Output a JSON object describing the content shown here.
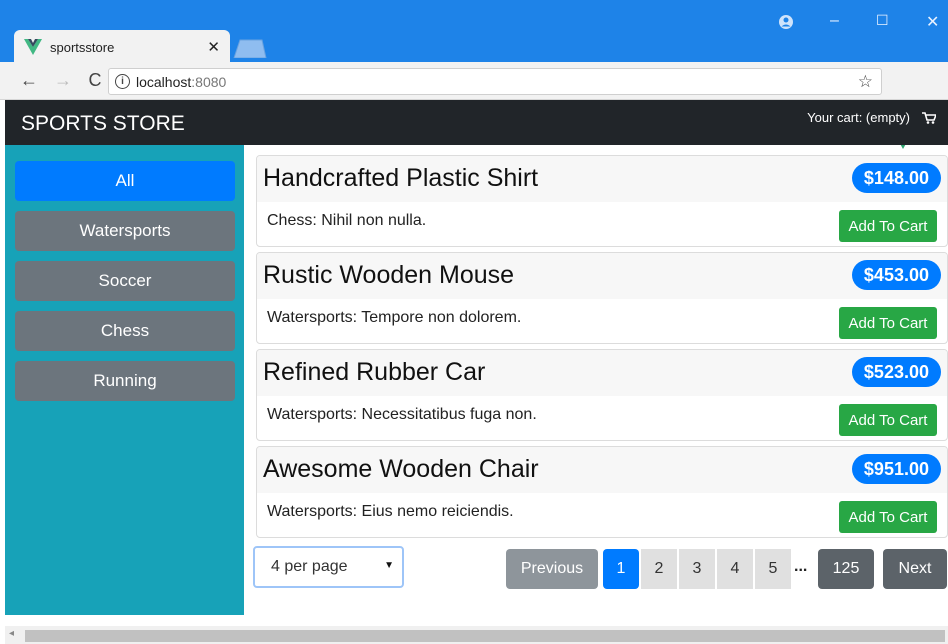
{
  "browser": {
    "tab_title": "sportsstore",
    "tab_close": "✕",
    "url_host": "localhost",
    "url_port": ":8080",
    "window_controls": [
      "–",
      "☐",
      "✕"
    ]
  },
  "navbar": {
    "brand": "SPORTS STORE",
    "cart_text": "Your cart: (empty)"
  },
  "sidebar": {
    "categories": [
      {
        "label": "All",
        "active": true
      },
      {
        "label": "Watersports",
        "active": false
      },
      {
        "label": "Soccer",
        "active": false
      },
      {
        "label": "Chess",
        "active": false
      },
      {
        "label": "Running",
        "active": false
      }
    ]
  },
  "products": [
    {
      "name": "Handcrafted Plastic Shirt",
      "price": "$148.00",
      "description": "Chess: Nihil non nulla.",
      "button": "Add To Cart"
    },
    {
      "name": "Rustic Wooden Mouse",
      "price": "$453.00",
      "description": "Watersports: Tempore non dolorem.",
      "button": "Add To Cart"
    },
    {
      "name": "Refined Rubber Car",
      "price": "$523.00",
      "description": "Watersports: Necessitatibus fuga non.",
      "button": "Add To Cart"
    },
    {
      "name": "Awesome Wooden Chair",
      "price": "$951.00",
      "description": "Watersports: Eius nemo reiciendis.",
      "button": "Add To Cart"
    }
  ],
  "pagination": {
    "page_size": "4 per page",
    "previous": "Previous",
    "pages": [
      "1",
      "2",
      "3",
      "4",
      "5"
    ],
    "ellipsis": "...",
    "last": "125",
    "next": "Next",
    "current": "1"
  },
  "colors": {
    "titlebar": "#1e83e8",
    "navbar": "#212529",
    "sidebar": "#17a2b8",
    "primary": "#007bff",
    "secondary": "#6c757d",
    "success": "#28a745"
  }
}
